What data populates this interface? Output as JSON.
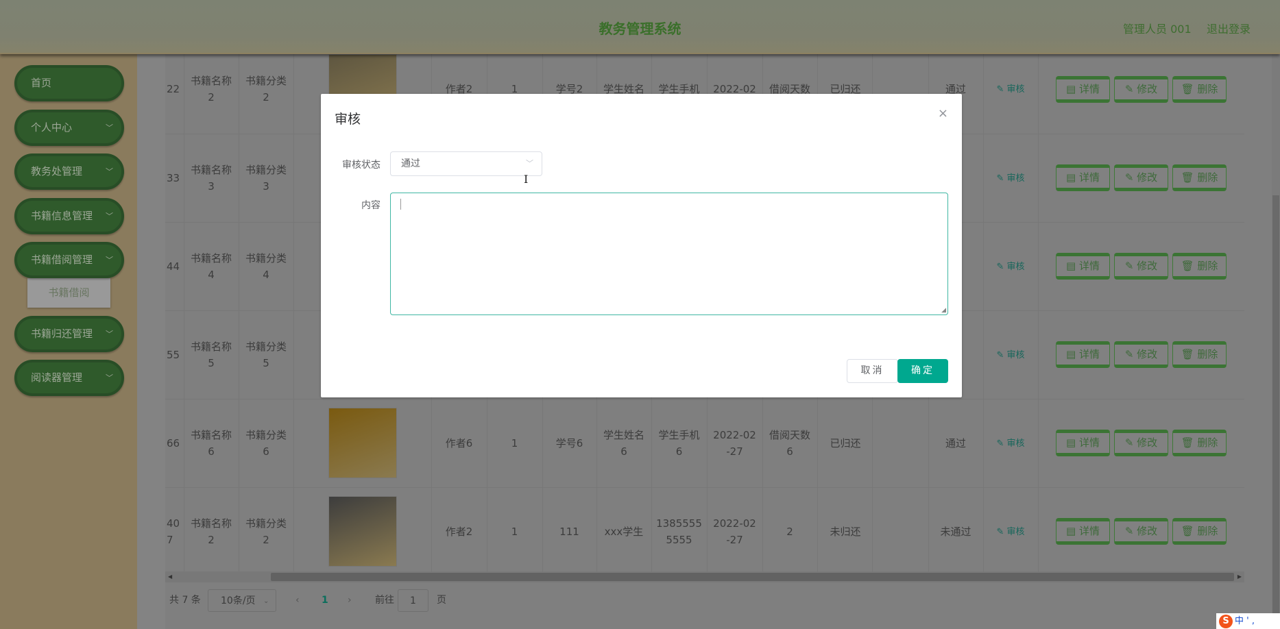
{
  "header": {
    "title": "教务管理系统",
    "user": "管理人员 001",
    "logout": "退出登录"
  },
  "sidebar": {
    "items": [
      {
        "label": "首页",
        "chevron": false
      },
      {
        "label": "个人中心",
        "chevron": true
      },
      {
        "label": "教务处管理",
        "chevron": true
      },
      {
        "label": "书籍信息管理",
        "chevron": true
      },
      {
        "label": "书籍借阅管理",
        "chevron": true
      },
      {
        "label": "书籍归还管理",
        "chevron": true
      },
      {
        "label": "阅读器管理",
        "chevron": true
      }
    ],
    "submenu": "书籍借阅"
  },
  "table": {
    "actions": {
      "audit": "审核",
      "detail": "详情",
      "edit": "修改",
      "delete": "删除"
    },
    "rows": [
      {
        "id": "22",
        "name": "书籍名称\n2",
        "cat": "书籍分类\n2",
        "cover": "#5e5640",
        "author": "作者2",
        "qty": "1",
        "sno": "学号2",
        "sname": "学生姓名",
        "sphone": "学生手机",
        "date": "2022-02",
        "days": "借阅天数",
        "ret": "已归还",
        "status": "通过"
      },
      {
        "id": "33",
        "name": "书籍名称\n3",
        "cat": "书籍分类\n3",
        "cover": "#6a6a6a",
        "author": "",
        "qty": "",
        "sno": "",
        "sname": "",
        "sphone": "",
        "date": "",
        "days": "",
        "ret": "",
        "status": ""
      },
      {
        "id": "44",
        "name": "书籍名称\n4",
        "cat": "书籍分类\n4",
        "cover": "#6a6a6a",
        "author": "",
        "qty": "",
        "sno": "",
        "sname": "",
        "sphone": "",
        "date": "",
        "days": "",
        "ret": "",
        "status": ""
      },
      {
        "id": "55",
        "name": "书籍名称\n5",
        "cat": "书籍分类\n5",
        "cover": "#6a6a6a",
        "author": "",
        "qty": "",
        "sno": "",
        "sname": "",
        "sphone": "",
        "date": "",
        "days": "",
        "ret": "",
        "status": ""
      },
      {
        "id": "66",
        "name": "书籍名称\n6",
        "cat": "书籍分类\n6",
        "cover": "#7a5a10",
        "author": "作者6",
        "qty": "1",
        "sno": "学号6",
        "sname": "学生姓名\n6",
        "sphone": "学生手机\n6",
        "date": "2022-02\n-27",
        "days": "借阅天数\n6",
        "ret": "已归还",
        "status": "通过"
      },
      {
        "id": "40\n7",
        "name": "书籍名称\n2",
        "cat": "书籍分类\n2",
        "cover": "#3d3d3d",
        "author": "作者2",
        "qty": "1",
        "sno": "111",
        "sname": "xxx学生",
        "sphone": "1385555\n5555",
        "date": "2022-02\n-27",
        "days": "2",
        "ret": "未归还",
        "status": "未通过"
      }
    ]
  },
  "pagination": {
    "total": "共 7 条",
    "page_size": "10条/页",
    "prev": "‹",
    "current": "1",
    "next": "›",
    "goto": "前往",
    "goto_value": "1",
    "page_unit": "页"
  },
  "modal": {
    "title": "审核",
    "close": "×",
    "status_label": "审核状态",
    "status_value": "通过",
    "content_label": "内容",
    "content_value": "",
    "cancel": "取消",
    "confirm": "确定"
  },
  "ime": {
    "label": "中 ' ,"
  },
  "colors": {
    "accent": "#00a88f",
    "sidebar_green": "#2f5a2b"
  }
}
